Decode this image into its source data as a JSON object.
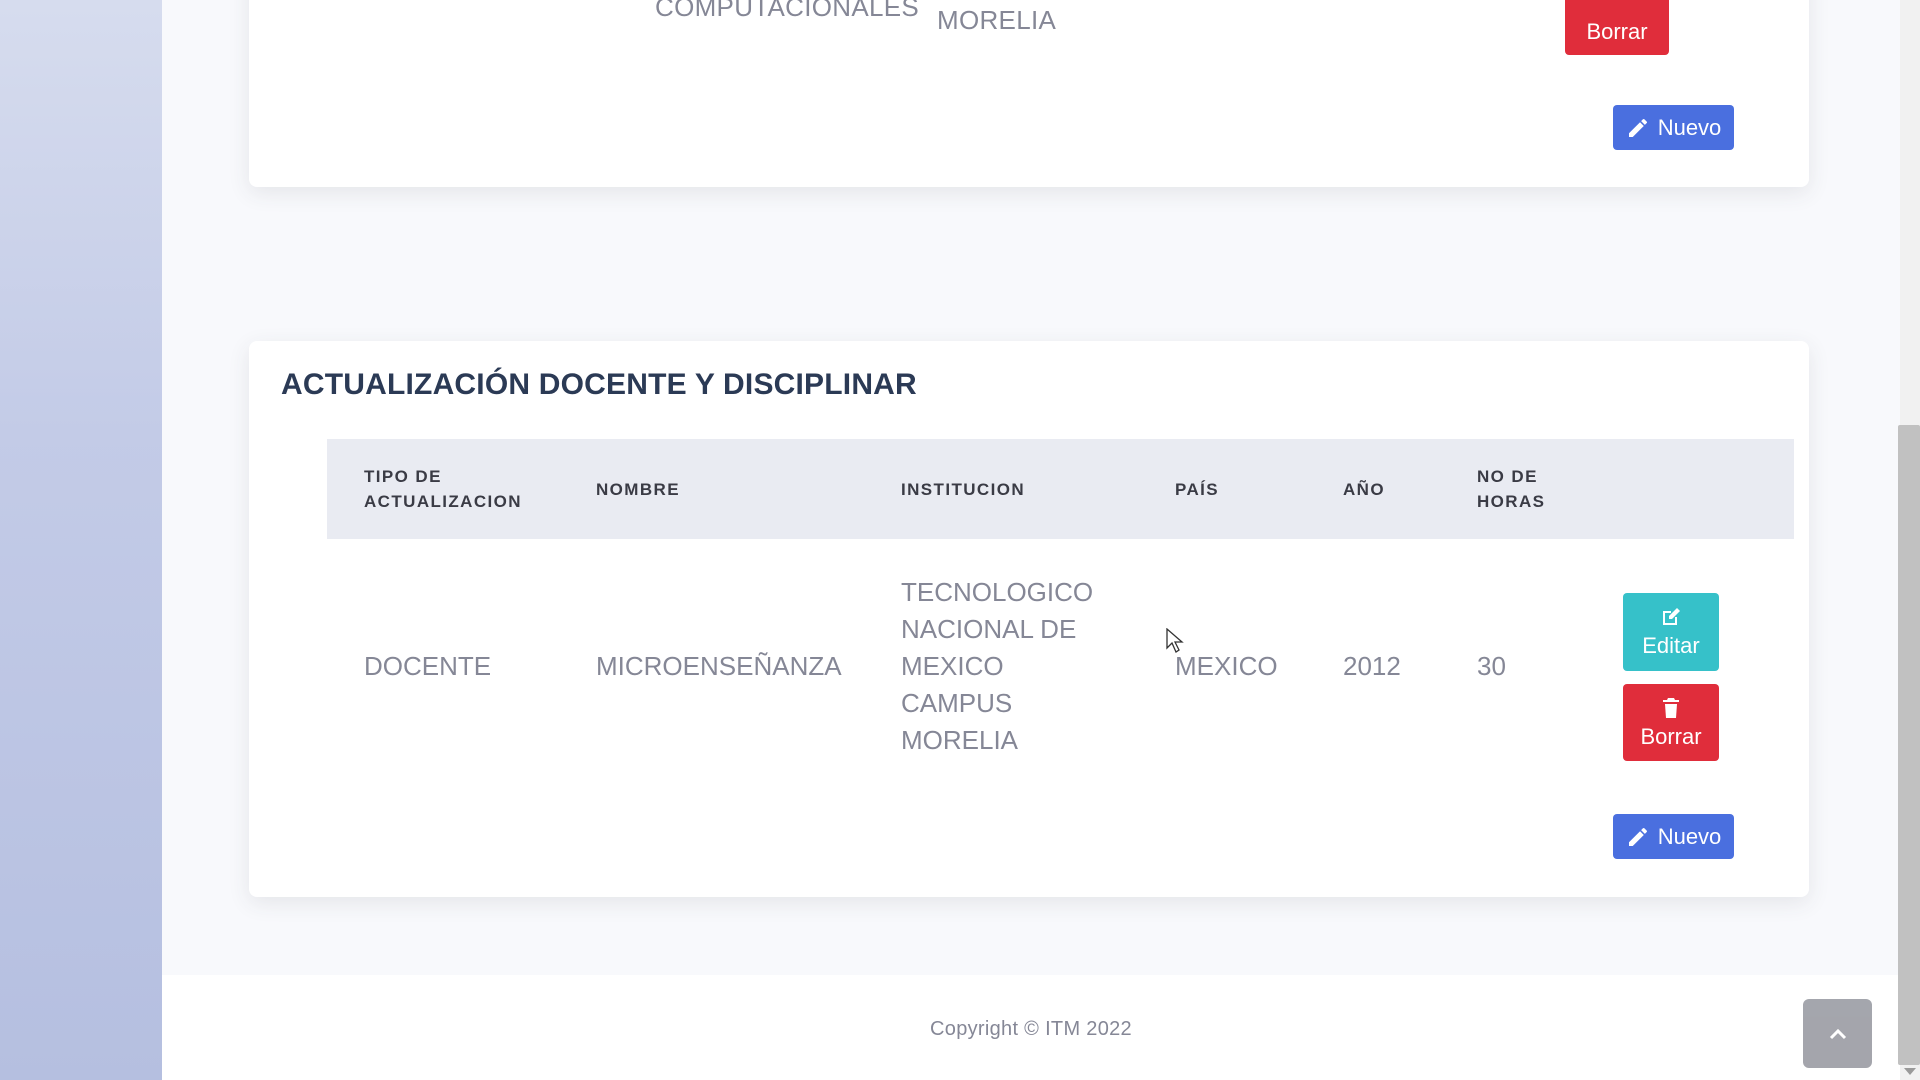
{
  "top_card": {
    "cells": [
      "COMPUTACIONALES",
      "MORELIA"
    ],
    "delete_label": "Borrar",
    "new_label": "Nuevo"
  },
  "main_card": {
    "title": "ACTUALIZACIÓN DOCENTE Y DISCIPLINAR",
    "columns": [
      "TIPO DE ACTUALIZACION",
      "NOMBRE",
      "INSTITUCION",
      "PAÍS",
      "AÑO",
      "NO DE HORAS"
    ],
    "rows": [
      {
        "tipo": "DOCENTE",
        "nombre": "MICROENSEÑANZA",
        "institucion": "TECNOLOGICO NACIONAL DE MEXICO CAMPUS MORELIA",
        "pais": "MEXICO",
        "anio": "2012",
        "horas": "30",
        "edit_label": "Editar",
        "delete_label": "Borrar"
      }
    ],
    "new_label": "Nuevo"
  },
  "footer": {
    "copyright": "Copyright © ITM 2022"
  },
  "colors": {
    "danger": "#e02d3b",
    "info": "#36c1c9",
    "primary": "#4a6fdf",
    "sidebar": "#c3cbe7"
  },
  "icons": {
    "edit": "edit-square-icon",
    "delete": "trash-icon",
    "new": "pencil-icon",
    "scroll_top": "chevron-up-icon"
  }
}
